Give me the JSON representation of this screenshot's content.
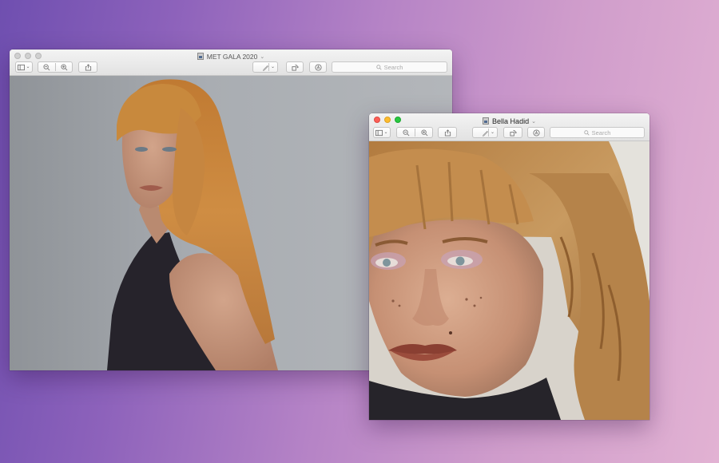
{
  "windows": {
    "met_gala": {
      "title": "MET GALA 2020",
      "search_placeholder": "Search",
      "toolbar_icons": [
        "sidebar-icon",
        "zoom-out-icon",
        "zoom-in-icon",
        "share-icon",
        "markup-pen-icon",
        "rotate-icon",
        "annotate-icon"
      ]
    },
    "bella_hadid": {
      "title": "Bella Hadid",
      "search_placeholder": "Search",
      "toolbar_icons": [
        "sidebar-icon",
        "zoom-out-icon",
        "zoom-in-icon",
        "share-icon",
        "markup-pen-icon",
        "rotate-icon",
        "annotate-icon"
      ]
    }
  },
  "colors": {
    "background_left": "#6f4fb0",
    "background_right": "#e2b2d3",
    "close": "#fc5f57",
    "minimize": "#fdbc2e",
    "zoom": "#29c840",
    "hair": "#c8893d"
  }
}
